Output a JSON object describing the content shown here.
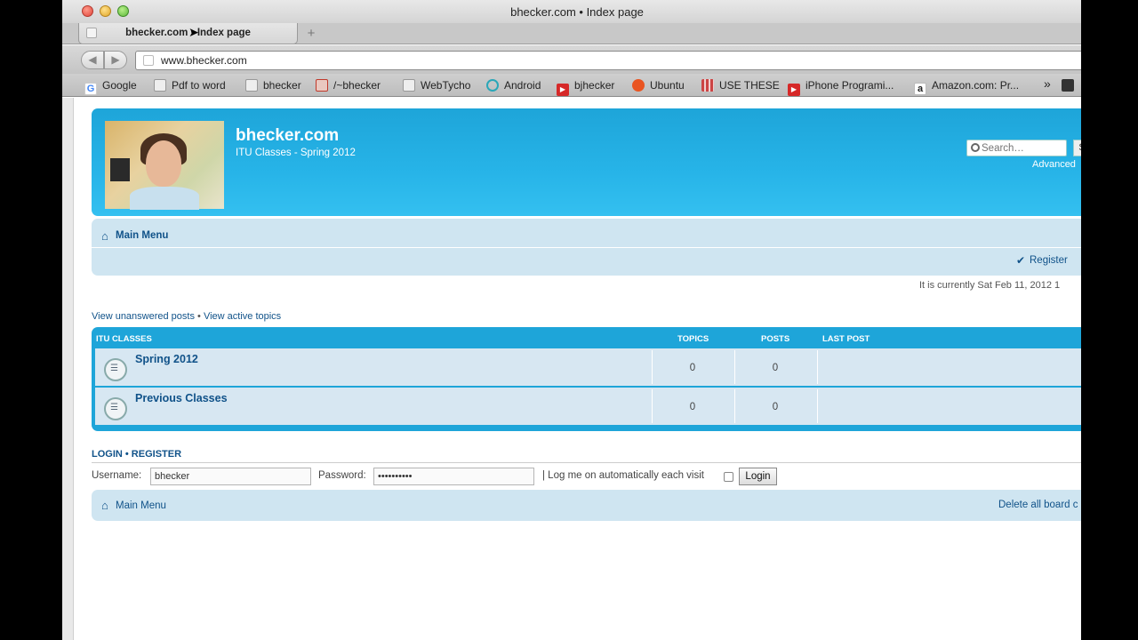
{
  "window": {
    "title": "bhecker.com • Index page"
  },
  "tab": {
    "title": "bhecker.com • Index page",
    "new_tab_glyph": "+"
  },
  "toolbar": {
    "url": "www.bhecker.com",
    "back_glyph": "◀",
    "forward_glyph": "▶"
  },
  "bookmarks": [
    {
      "label": "Google",
      "icon": "google-icon",
      "color": "#4285f4"
    },
    {
      "label": "Pdf to word",
      "icon": "page-icon"
    },
    {
      "label": "bhecker",
      "icon": "page-icon"
    },
    {
      "label": "/~bhecker",
      "icon": "scripts-icon",
      "color": "#c0392b"
    },
    {
      "label": "WebTycho",
      "icon": "page-icon"
    },
    {
      "label": "Android",
      "icon": "android-icon",
      "color": "#2aa7b8"
    },
    {
      "label": "bjhecker",
      "icon": "youtube-icon",
      "color": "#d62828"
    },
    {
      "label": "Ubuntu",
      "icon": "ubuntu-icon",
      "color": "#e95420"
    },
    {
      "label": "USE THESE",
      "icon": "grid-icon",
      "color": "#cc4444"
    },
    {
      "label": "iPhone Programi...",
      "icon": "youtube-icon",
      "color": "#d62828"
    },
    {
      "label": "Amazon.com: Pr...",
      "icon": "amazon-icon",
      "color": "#222222"
    }
  ],
  "bookmarks_overflow": "»",
  "header": {
    "site_title": "bhecker.com",
    "site_desc": "ITU Classes - Spring 2012",
    "search_placeholder": "Search…",
    "search_button": "S",
    "advanced": "Advanced"
  },
  "navbar": {
    "main_menu": "Main Menu",
    "register": "Register"
  },
  "time_text": "It is currently Sat Feb 11, 2012 1",
  "quicklinks": {
    "unanswered": "View unanswered posts",
    "separator": " • ",
    "active": "View active topics"
  },
  "forum": {
    "headers": {
      "category": "ITU CLASSES",
      "topics": "TOPICS",
      "posts": "POSTS",
      "last_post": "LAST POST"
    },
    "rows": [
      {
        "title": "Spring 2012",
        "topics": "0",
        "posts": "0"
      },
      {
        "title": "Previous Classes",
        "topics": "0",
        "posts": "0"
      }
    ]
  },
  "login": {
    "heading": "LOGIN • REGISTER",
    "username_label": "Username:",
    "username_value": "bhecker",
    "password_label": "Password:",
    "password_value": "••••••••••",
    "autologin_label": "| Log me on automatically each visit",
    "login_button": "Login"
  },
  "footer": {
    "main_menu": "Main Menu",
    "delete_cookies": "Delete all board c"
  },
  "colors": {
    "header_blue": "#27b4e8",
    "link_blue": "#105289",
    "nav_bg": "#cfe5f1"
  }
}
